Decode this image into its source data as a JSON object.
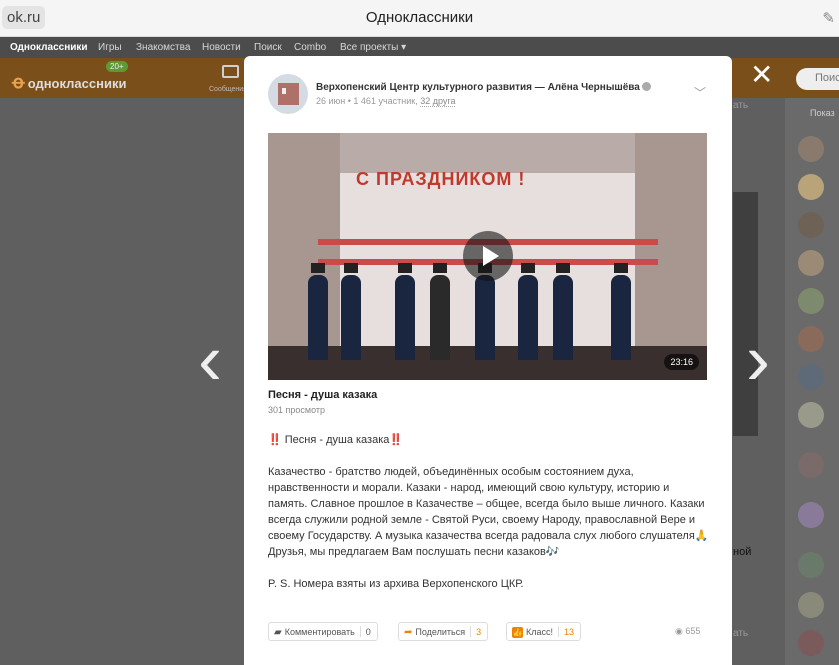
{
  "browser": {
    "url": "ok.ru",
    "window_title": "Одноклассники"
  },
  "topnav": {
    "items": [
      "Одноклассники",
      "Игры",
      "Знакомства",
      "Новости",
      "Поиск",
      "Combo",
      "Все проекты ▾"
    ]
  },
  "header": {
    "logo": "одноклассники",
    "logo_badge": "20+",
    "mail_label": "Сообщения",
    "search_placeholder": "Поиск"
  },
  "background": {
    "right_panel_title": "Показ",
    "ghost_text_1": "ать",
    "ghost_text_2": "ать",
    "ghost_text_3": "ной"
  },
  "nav": {
    "prev_arrow": "‹",
    "next_arrow": "›",
    "close": "✕"
  },
  "post": {
    "group_name": "Верхопенский Центр культурного развития — Алёна Чернышёва",
    "date": "26 июн",
    "participants": "1 461 участник",
    "friends": "32 друга",
    "video": {
      "duration": "23:16",
      "title": "Песня - душа казака",
      "views": "301 просмотр",
      "stage_banner": "С ПРАЗДНИКОМ !"
    },
    "text_lines": [
      "‼️ Песня - душа казака‼️",
      "",
      "Казачество - братство людей, объединённых особым состоянием духа, нравственности и морали. Казаки - народ, имеющий свою культуру, историю и память. Славное прошлое в Казачестве – общее, всегда было выше личного. Казаки всегда служили родной земле - Святой Руси, своему Народу, православной Вере и своему Государству. А музыка казачества всегда радовала слух любого слушателя🙏",
      "Друзья, мы предлагаем Вам послушать песни казаков🎶",
      "",
      "P. S. Номера взяты из архива Верхопенского ЦКР."
    ],
    "actions": {
      "comment": {
        "label": "Комментировать",
        "count": "0"
      },
      "share": {
        "label": "Поделиться",
        "count": "3"
      },
      "klass": {
        "label": "Класс!",
        "count": "13"
      }
    },
    "view_count": "655"
  },
  "colors": {
    "accent": "#ee8208",
    "overlay": "#5f5f5f",
    "card": "#ffffff"
  }
}
